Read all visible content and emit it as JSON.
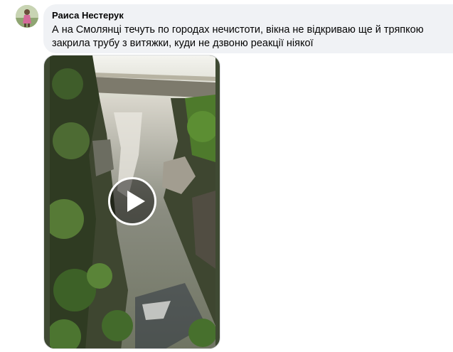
{
  "comment": {
    "author": "Раиса Нестерук",
    "text": "А на Смолянці течуть по городах нечистоти, вікна не відкриваю ще й тряпкою закрила трубу з витяжки, куди не дзвоню реакції ніякої",
    "avatar_icon": "user-avatar-photo"
  },
  "video": {
    "play_icon": "play-icon",
    "thumbnail": "stream-with-dirty-water-under-bridge"
  },
  "colors": {
    "bubble_bg": "#f0f2f5",
    "text": "#050505"
  }
}
